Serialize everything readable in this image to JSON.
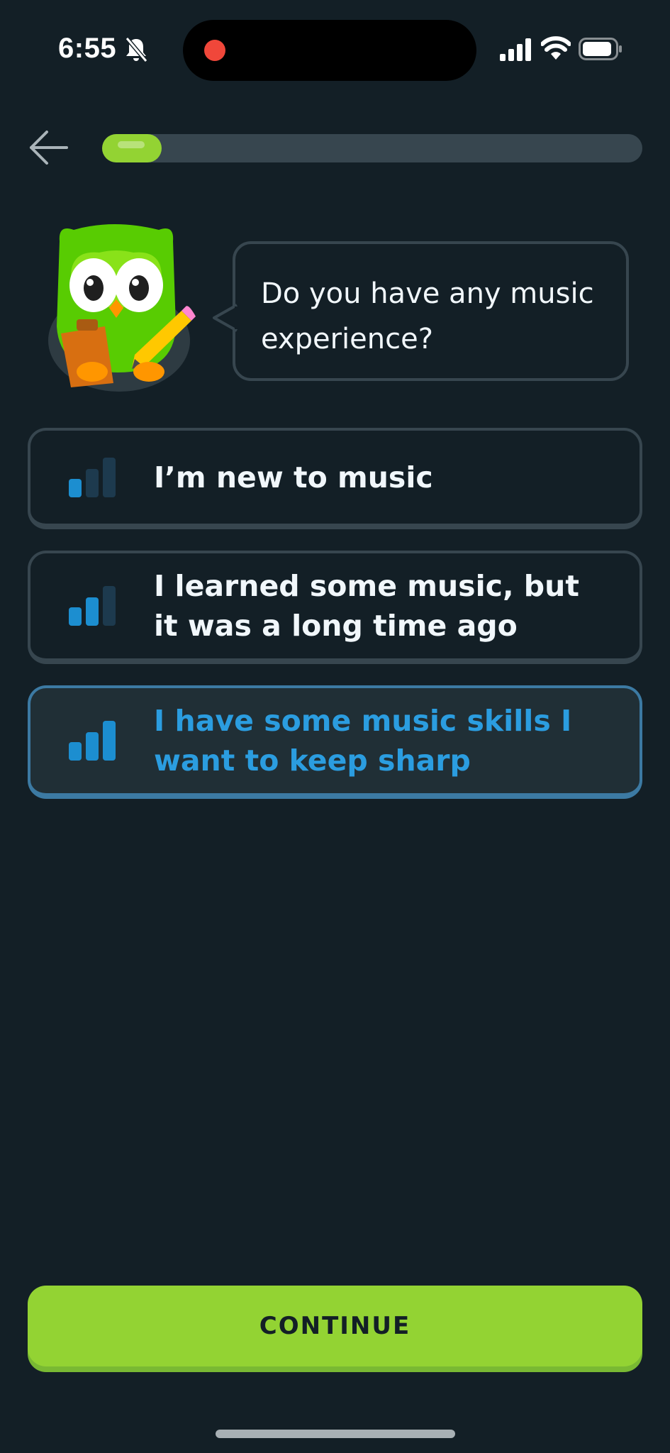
{
  "status_bar": {
    "time": "6:55",
    "icons": [
      "bell-slash-icon",
      "signal-icon",
      "wifi-icon",
      "battery-icon"
    ],
    "recording": true
  },
  "header": {
    "back_icon": "arrow-left-icon",
    "progress": 0.11,
    "progress_color": "#93d333"
  },
  "prompt": {
    "question": "Do you have any music experience?"
  },
  "options": [
    {
      "label": "I’m new to music",
      "level": 1,
      "selected": false
    },
    {
      "label": "I learned some music, but it was a long time ago",
      "level": 2,
      "selected": false
    },
    {
      "label": "I have some music skills I want to keep sharp",
      "level": 3,
      "selected": true
    }
  ],
  "continue_button": {
    "label": "CONTINUE",
    "color": "#93d333"
  },
  "colors": {
    "background": "#131f26",
    "border": "#37464f",
    "selected_border": "#3c7aa3",
    "selected_text": "#2b9de0",
    "bar_active": "#1c8ed0",
    "bar_inactive": "#1d3a4e"
  }
}
